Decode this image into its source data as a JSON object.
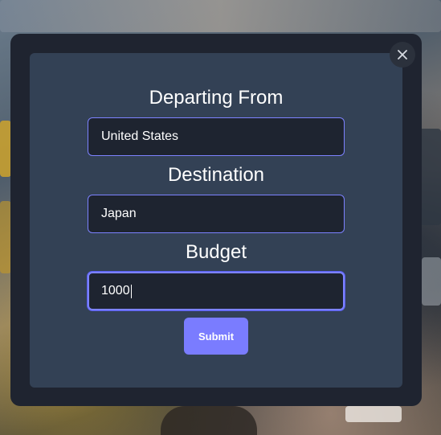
{
  "form": {
    "departing_label": "Departing From",
    "departing_value": "United States",
    "destination_label": "Destination",
    "destination_value": "Japan",
    "budget_label": "Budget",
    "budget_value": "1000",
    "submit_label": "Submit"
  },
  "icons": {
    "close": "close-icon"
  },
  "colors": {
    "modal_bg": "#1f2430",
    "panel_bg": "#334155",
    "input_bg": "#1e2430",
    "input_border": "#7c82ff",
    "button_bg": "#7a7cff"
  }
}
